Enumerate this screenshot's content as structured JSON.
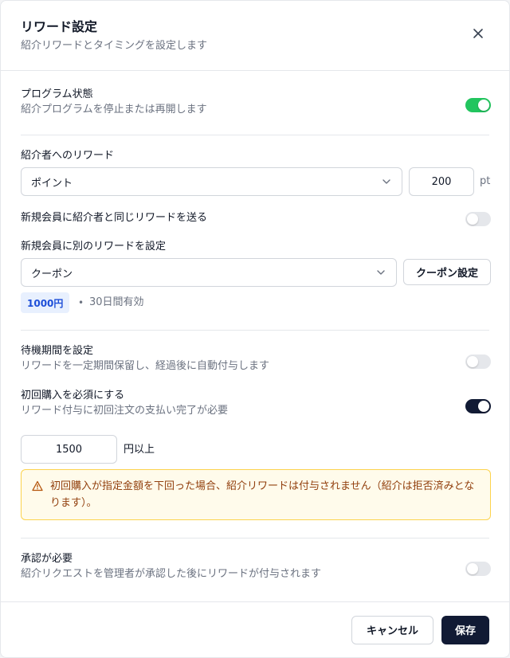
{
  "header": {
    "title": "リワード設定",
    "subtitle": "紹介リワードとタイミングを設定します"
  },
  "program": {
    "label": "プログラム状態",
    "desc": "紹介プログラムを停止または再開します",
    "enabled": true
  },
  "referrer_reward": {
    "label": "紹介者へのリワード",
    "type": "ポイント",
    "amount": "200",
    "unit": "pt"
  },
  "same_reward": {
    "label": "新規会員に紹介者と同じリワードを送る",
    "enabled": false
  },
  "new_member_reward": {
    "label": "新規会員に別のリワードを設定",
    "type": "クーポン",
    "settings_button": "クーポン設定",
    "coupon_value": "1000円",
    "separator": "•",
    "validity": "30日間有効"
  },
  "waiting": {
    "label": "待機期間を設定",
    "desc": "リワードを一定期間保留し、経過後に自動付与します",
    "enabled": false
  },
  "first_purchase": {
    "label": "初回購入を必須にする",
    "desc": "リワード付与に初回注文の支払い完了が必要",
    "enabled": true,
    "min_amount": "1500",
    "min_suffix": "円以上",
    "alert": "初回購入が指定金額を下回った場合、紹介リワードは付与されません（紹介は拒否済みとなります）。"
  },
  "approval": {
    "label": "承認が必要",
    "desc": "紹介リクエストを管理者が承認した後にリワードが付与されます",
    "enabled": false
  },
  "footer": {
    "cancel": "キャンセル",
    "save": "保存"
  },
  "colors": {
    "toggle_green": "#22c55e",
    "toggle_dark": "#111a34",
    "toggle_off": "#e5e7eb",
    "primary": "#111a34"
  },
  "icons": [
    "close-icon",
    "chevron-down-icon",
    "warning-icon"
  ]
}
